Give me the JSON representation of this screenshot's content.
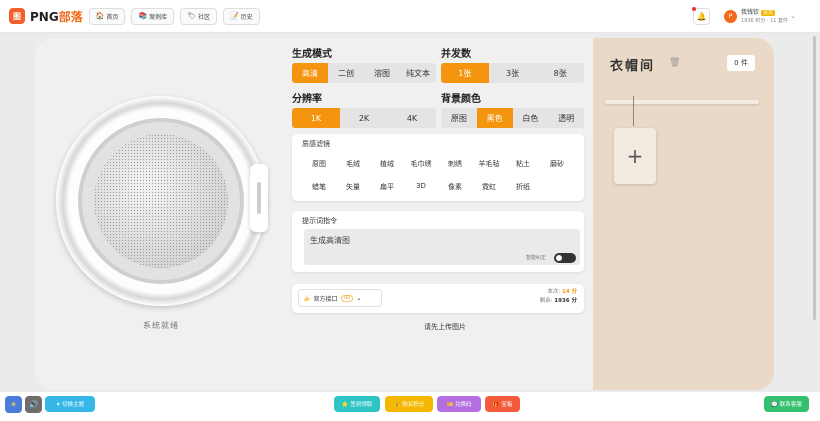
{
  "header": {
    "logo_glyph": "图",
    "brand_main": "PNG",
    "brand_accent": "部落",
    "nav": [
      {
        "label": "首页",
        "icon": "home-icon",
        "glyph": "🏠"
      },
      {
        "label": "案例库",
        "icon": "case-library-icon",
        "glyph": "📚"
      },
      {
        "label": "社区",
        "icon": "community-icon",
        "glyph": "🏷"
      },
      {
        "label": "历史",
        "icon": "history-icon",
        "glyph": "📝"
      }
    ],
    "bell_glyph": "🔔",
    "user": {
      "avatar_letter": "P",
      "name": "我钱钦",
      "vip": "会员",
      "points": "1936 积分 · 11 套件",
      "caret": "⌄"
    }
  },
  "left": {
    "status": "系统就绪"
  },
  "controls": {
    "mode_title": "生成模式",
    "modes": [
      "高清",
      "二创",
      "溶图",
      "纯文本"
    ],
    "mode_active": 0,
    "concurrency_title": "并发数",
    "concurrency": [
      "1张",
      "3张",
      "8张"
    ],
    "concurrency_active": 0,
    "resolution_title": "分辨率",
    "resolutions": [
      "1K",
      "2K",
      "4K"
    ],
    "resolution_active": 0,
    "bg_title": "背景颜色",
    "bg_colors": [
      "原图",
      "黑色",
      "白色",
      "透明"
    ],
    "bg_active": 1,
    "filter_title": "质感滤镜",
    "filters_row1": [
      "原图",
      "毛绒",
      "植绒",
      "毛巾绣",
      "刺绣",
      "羊毛毡",
      "粘土",
      "磨砂"
    ],
    "filters_row2": [
      "蜡笔",
      "矢量",
      "扁平",
      "3D",
      "像素",
      "霓虹",
      "折纸"
    ],
    "prompt_title": "提示词指令",
    "prompt_text": "生成高清图",
    "smart_correct": "智能纠正",
    "api_label": "官方接口",
    "api_tag": "HD",
    "api_caret": "⌄",
    "cost_label": "本次:",
    "cost_value": "14 分",
    "remaining_label": "剩余:",
    "remaining_value": "1936 分",
    "upload_hint": "请先上传图片"
  },
  "wardrobe": {
    "title": "衣帽间",
    "trash_glyph": "🗑",
    "count": "0 件",
    "add_glyph": "+"
  },
  "footer": {
    "theme_label": "✦ 切换主题",
    "checkin": "⭐ 签到领取",
    "points": "💰 购买积分",
    "redeem": "🎫 兑换码",
    "treasure": "🎁 宝箱",
    "service": "💬 联系客服",
    "sun_glyph": "☀",
    "sound_glyph": "🔊"
  }
}
